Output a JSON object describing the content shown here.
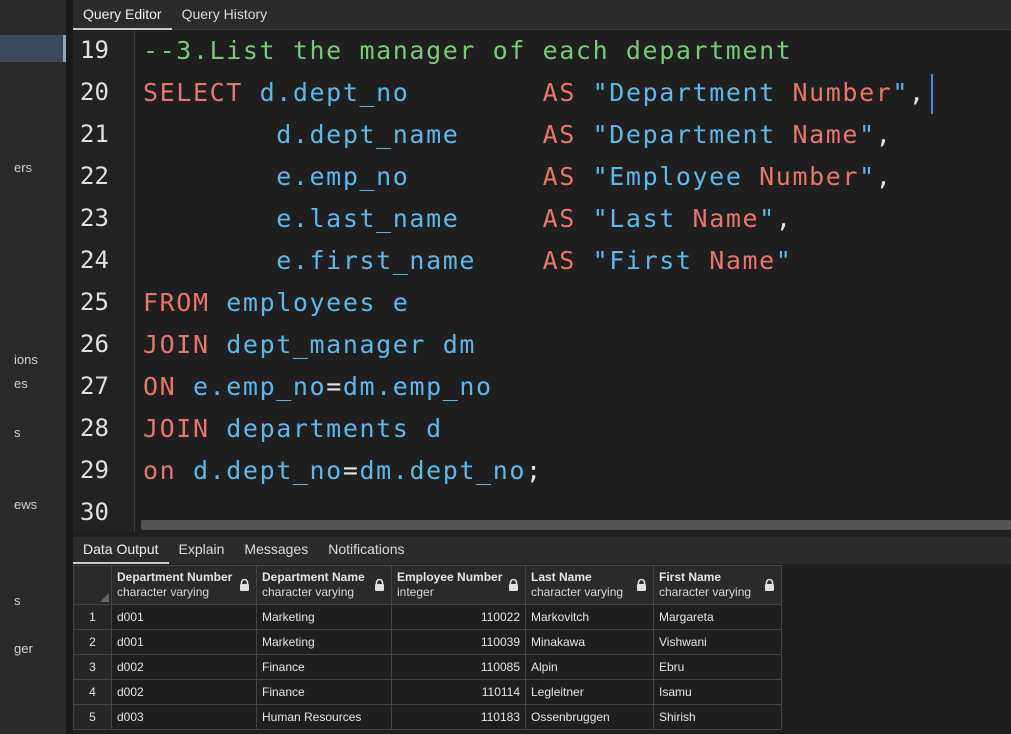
{
  "sidebar": {
    "fragments": [
      "ers",
      "ions",
      "es",
      "s",
      "ews",
      "s",
      "ger"
    ]
  },
  "query_tabs": [
    "Query Editor",
    "Query History"
  ],
  "editor": {
    "line_numbers": [
      "19",
      "20",
      "21",
      "22",
      "23",
      "24",
      "25",
      "26",
      "27",
      "28",
      "29",
      "30"
    ],
    "lines": [
      [
        {
          "t": "cm",
          "v": "--3.List the manager of each department"
        }
      ],
      [
        {
          "t": "kw",
          "v": "SELECT"
        },
        {
          "t": "pl",
          "v": " "
        },
        {
          "t": "id",
          "v": "d.dept_no"
        },
        {
          "t": "pl",
          "v": "        "
        },
        {
          "t": "kw",
          "v": "AS"
        },
        {
          "t": "pl",
          "v": " "
        },
        {
          "t": "str",
          "v": "\"Department "
        },
        {
          "t": "kw",
          "v": "Number"
        },
        {
          "t": "str",
          "v": "\""
        },
        {
          "t": "pl",
          "v": ","
        }
      ],
      [
        {
          "t": "pl",
          "v": "        "
        },
        {
          "t": "id",
          "v": "d.dept_name"
        },
        {
          "t": "pl",
          "v": "     "
        },
        {
          "t": "kw",
          "v": "AS"
        },
        {
          "t": "pl",
          "v": " "
        },
        {
          "t": "str",
          "v": "\"Department "
        },
        {
          "t": "kw",
          "v": "Name"
        },
        {
          "t": "str",
          "v": "\""
        },
        {
          "t": "pl",
          "v": ","
        }
      ],
      [
        {
          "t": "pl",
          "v": "        "
        },
        {
          "t": "id",
          "v": "e.emp_no"
        },
        {
          "t": "pl",
          "v": "        "
        },
        {
          "t": "kw",
          "v": "AS"
        },
        {
          "t": "pl",
          "v": " "
        },
        {
          "t": "str",
          "v": "\"Employee "
        },
        {
          "t": "kw",
          "v": "Number"
        },
        {
          "t": "str",
          "v": "\""
        },
        {
          "t": "pl",
          "v": ","
        }
      ],
      [
        {
          "t": "pl",
          "v": "        "
        },
        {
          "t": "id",
          "v": "e.last_name"
        },
        {
          "t": "pl",
          "v": "     "
        },
        {
          "t": "kw",
          "v": "AS"
        },
        {
          "t": "pl",
          "v": " "
        },
        {
          "t": "str",
          "v": "\"Last "
        },
        {
          "t": "kw",
          "v": "Name"
        },
        {
          "t": "str",
          "v": "\""
        },
        {
          "t": "pl",
          "v": ","
        }
      ],
      [
        {
          "t": "pl",
          "v": "        "
        },
        {
          "t": "id",
          "v": "e.first_name"
        },
        {
          "t": "pl",
          "v": "    "
        },
        {
          "t": "kw",
          "v": "AS"
        },
        {
          "t": "pl",
          "v": " "
        },
        {
          "t": "str",
          "v": "\"First "
        },
        {
          "t": "kw",
          "v": "Name"
        },
        {
          "t": "str",
          "v": "\""
        }
      ],
      [
        {
          "t": "kw",
          "v": "FROM"
        },
        {
          "t": "pl",
          "v": " "
        },
        {
          "t": "id",
          "v": "employees e"
        }
      ],
      [
        {
          "t": "kw",
          "v": "JOIN"
        },
        {
          "t": "pl",
          "v": " "
        },
        {
          "t": "id",
          "v": "dept_manager dm"
        }
      ],
      [
        {
          "t": "kw",
          "v": "ON"
        },
        {
          "t": "pl",
          "v": " "
        },
        {
          "t": "id",
          "v": "e.emp_no"
        },
        {
          "t": "pl",
          "v": "="
        },
        {
          "t": "id",
          "v": "dm.emp_no"
        }
      ],
      [
        {
          "t": "kw",
          "v": "JOIN"
        },
        {
          "t": "pl",
          "v": " "
        },
        {
          "t": "id",
          "v": "departments d"
        }
      ],
      [
        {
          "t": "kw",
          "v": "on"
        },
        {
          "t": "pl",
          "v": " "
        },
        {
          "t": "id",
          "v": "d.dept_no"
        },
        {
          "t": "pl",
          "v": "="
        },
        {
          "t": "id",
          "v": "dm.dept_no"
        },
        {
          "t": "pl",
          "v": ";"
        }
      ],
      []
    ]
  },
  "output_tabs": [
    "Data Output",
    "Explain",
    "Messages",
    "Notifications"
  ],
  "grid": {
    "columns": [
      {
        "name": "Department Number",
        "type": "character varying"
      },
      {
        "name": "Department Name",
        "type": "character varying"
      },
      {
        "name": "Employee Number",
        "type": "integer"
      },
      {
        "name": "Last Name",
        "type": "character varying"
      },
      {
        "name": "First Name",
        "type": "character varying"
      }
    ],
    "rows": [
      [
        "1",
        "d001",
        "Marketing",
        "110022",
        "Markovitch",
        "Margareta"
      ],
      [
        "2",
        "d001",
        "Marketing",
        "110039",
        "Minakawa",
        "Vishwani"
      ],
      [
        "3",
        "d002",
        "Finance",
        "110085",
        "Alpin",
        "Ebru"
      ],
      [
        "4",
        "d002",
        "Finance",
        "110114",
        "Legleitner",
        "Isamu"
      ],
      [
        "5",
        "d003",
        "Human Resources",
        "110183",
        "Ossenbruggen",
        "Shirish"
      ]
    ]
  },
  "colors": {
    "keyword": "#e8776b",
    "identifier": "#5fb8ea",
    "comment": "#7cc87a",
    "background": "#1f1f1f"
  }
}
